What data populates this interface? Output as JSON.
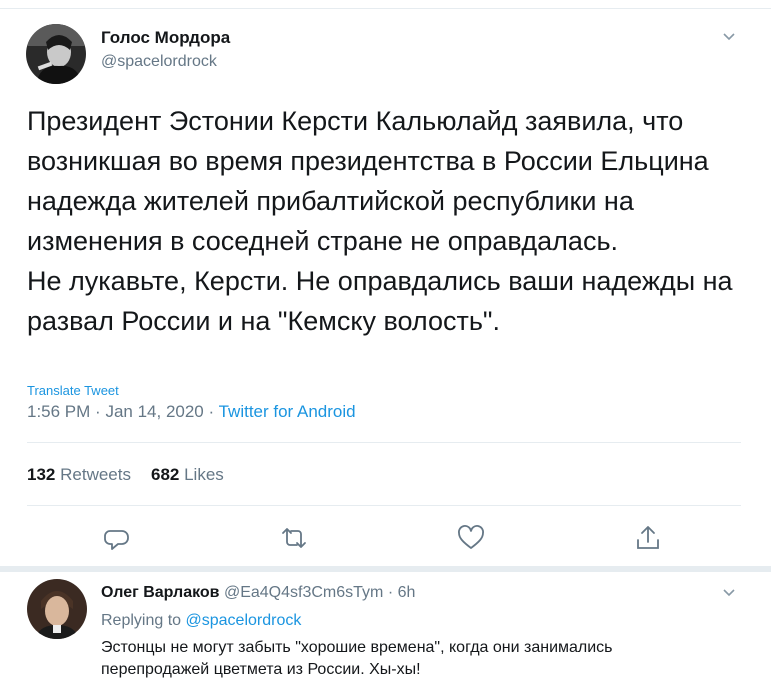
{
  "tweet": {
    "author_name": "Голос Мордора",
    "author_handle": "@spacelordrock",
    "text": "Президент Эстонии Керсти Кальюлайд заявила, что возникшая во время президентства в России Ельцина надежда жителей прибалтийской республики на изменения в соседней стране не оправдалась.\nНе лукавьте, Керсти. Не оправдались ваши надежды на развал России и на \"Кемску волость\".",
    "translate_label": "Translate Tweet",
    "time": "1:56 PM",
    "date": "Jan 14, 2020",
    "separator": "·",
    "source": "Twitter for Android",
    "retweets_count": "132",
    "retweets_label": "Retweets",
    "likes_count": "682",
    "likes_label": "Likes"
  },
  "reply": {
    "author_name": "Олег Варлаков",
    "author_handle": "@Ea4Q4sf3Cm6sTym",
    "separator": "·",
    "age": "6h",
    "replying_prefix": "Replying to",
    "replying_to": "@spacelordrock",
    "text": "Эстонцы не могут забыть \"хорошие времена\", когда они занимались\nперепродажей цветмета из России. Хы-хы!"
  },
  "icons": {
    "reply": "reply-icon",
    "retweet": "retweet-icon",
    "like": "heart-icon",
    "share": "share-icon",
    "menu": "chevron-down-icon"
  },
  "colors": {
    "link": "#1b95e0",
    "secondary": "#657786",
    "border": "#e6ecf0",
    "text": "#14171a"
  }
}
